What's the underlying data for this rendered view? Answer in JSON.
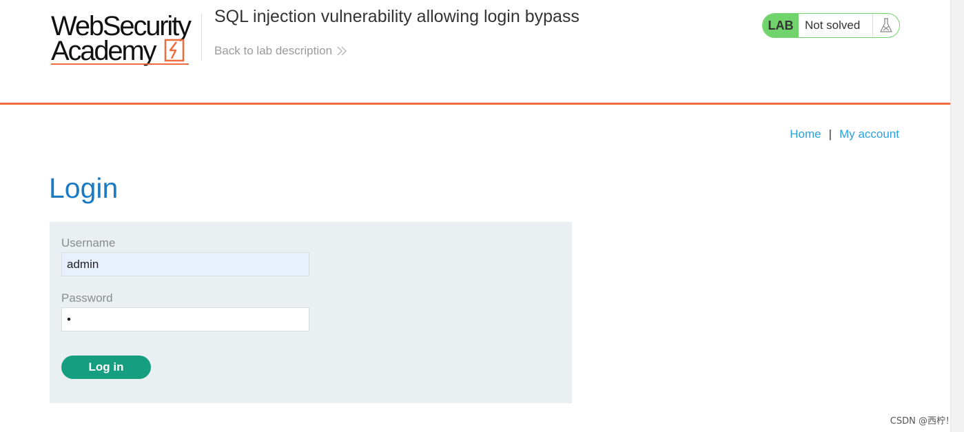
{
  "header": {
    "logo": {
      "line1": "WebSecurity",
      "line2": "Academy"
    },
    "lab_title": "SQL injection vulnerability allowing login bypass",
    "back_link": "Back to lab description",
    "lab_status": {
      "badge": "LAB",
      "state": "Not solved",
      "icon": "flask-icon"
    }
  },
  "nav": {
    "home": "Home",
    "separator": "|",
    "my_account": "My account"
  },
  "login": {
    "heading": "Login",
    "username_label": "Username",
    "username_value": "admin",
    "password_label": "Password",
    "password_value": "a",
    "button_label": "Log in"
  },
  "watermark": "CSDN @西柠！",
  "colors": {
    "accent_orange": "#ef6a3d",
    "status_green": "#70d36b",
    "link_blue": "#29a2e0",
    "heading_blue": "#1b7ac4",
    "button_teal": "#159e7f"
  }
}
